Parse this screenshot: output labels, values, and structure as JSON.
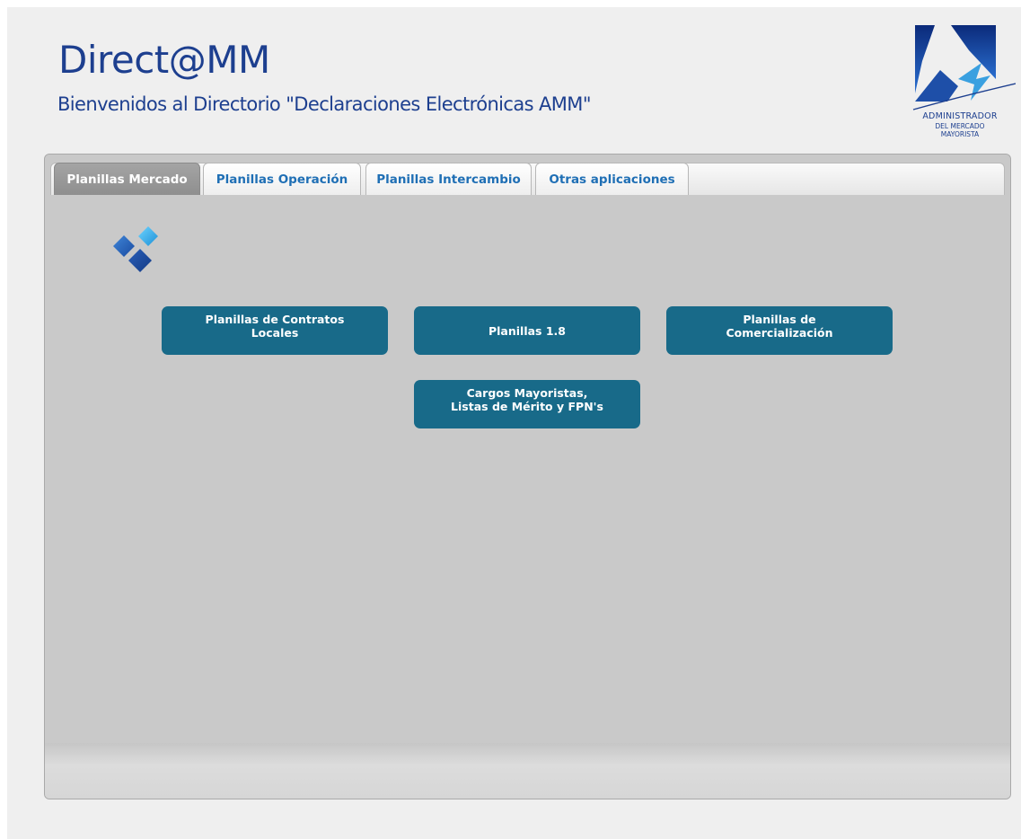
{
  "header": {
    "title": "Direct@MM",
    "subtitle": "Bienvenidos al Directorio \"Declaraciones Electrónicas AMM\""
  },
  "logo": {
    "line1": "ADMINISTRADOR",
    "line2": "DEL MERCADO",
    "line3": "MAYORISTA"
  },
  "tabs": [
    {
      "label": "Planillas Mercado",
      "active": true
    },
    {
      "label": "Planillas Operación",
      "active": false
    },
    {
      "label": "Planillas Intercambio",
      "active": false
    },
    {
      "label": "Otras aplicaciones",
      "active": false
    }
  ],
  "buttons": [
    {
      "label": "Planillas de Contratos Locales"
    },
    {
      "label": "Planillas 1.8"
    },
    {
      "label": "Planillas de Comercialización"
    },
    {
      "label": "Cargos Mayoristas, Listas de Mérito y FPN's"
    }
  ],
  "icons": {
    "section_icon": "diamond-cluster-icon"
  },
  "colors": {
    "brand_blue": "#1d3f8f",
    "button_teal": "#186a89",
    "tab_text": "#1f6fb5",
    "active_tab": "#9a9a9a"
  }
}
